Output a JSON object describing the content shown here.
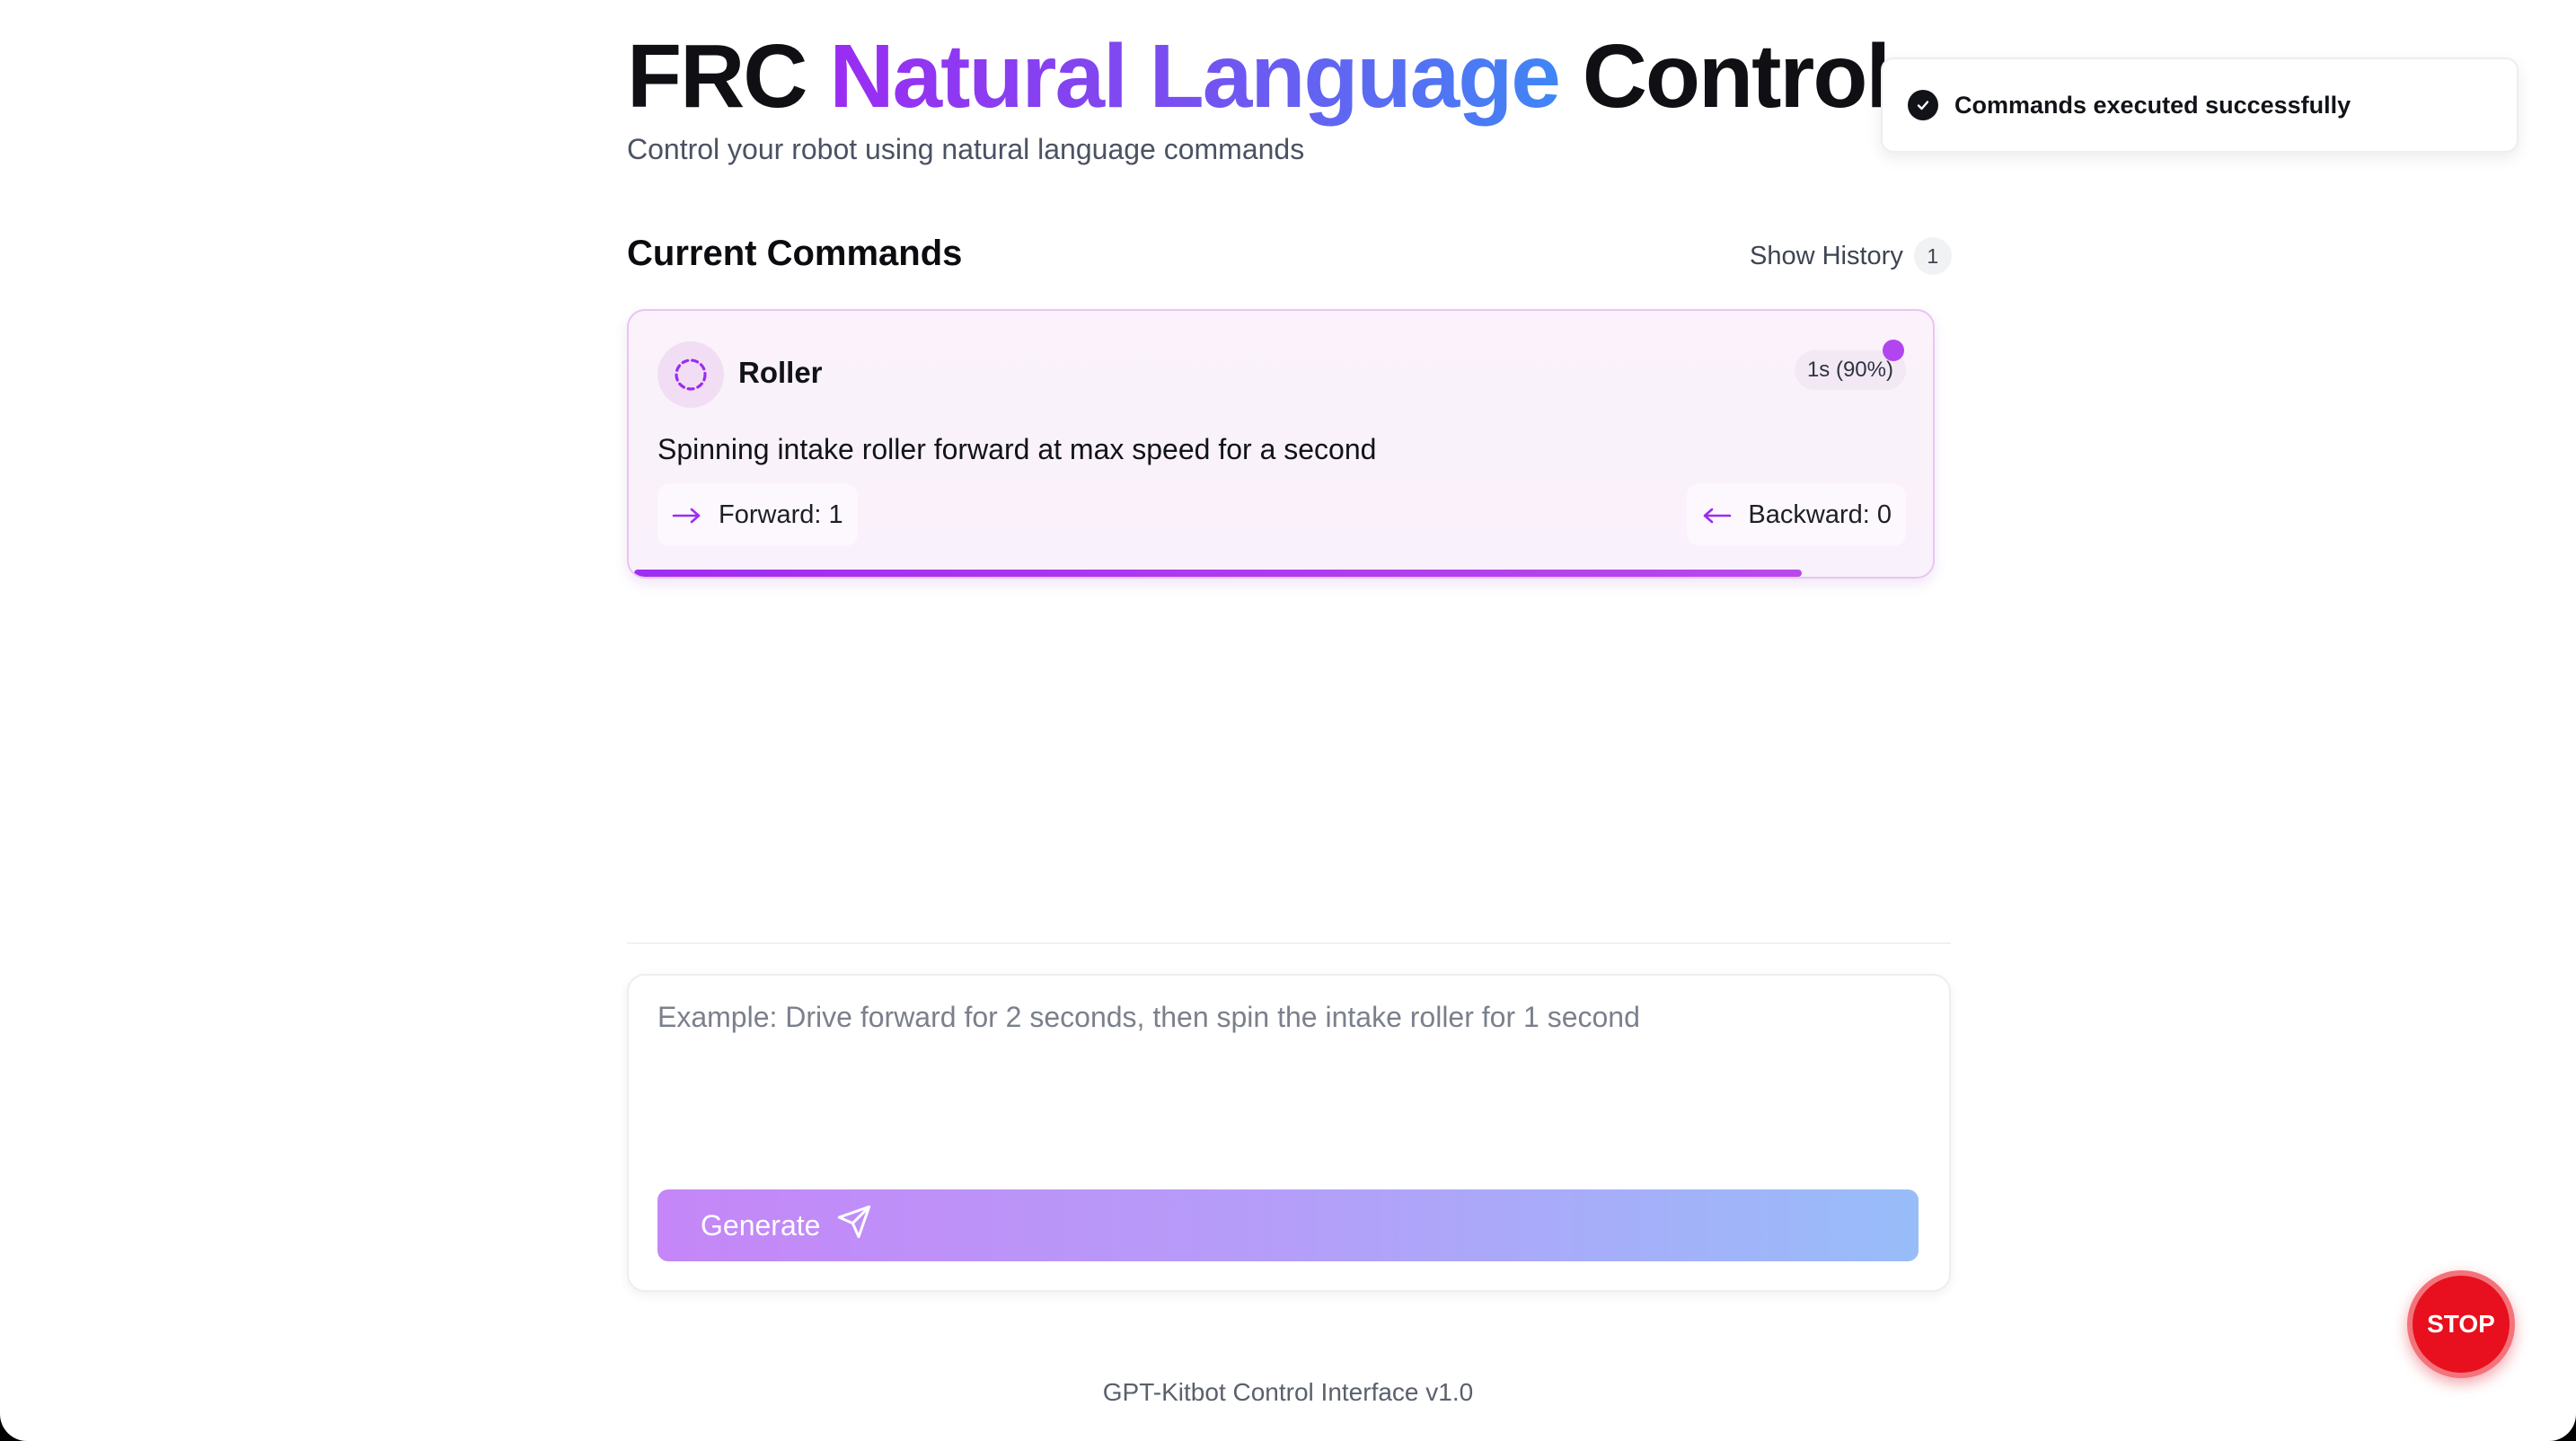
{
  "header": {
    "title_part1": "FRC",
    "title_highlight": "Natural Language",
    "title_part2": "Control",
    "subtitle": "Control your robot using natural language commands"
  },
  "commands_section": {
    "title": "Current Commands",
    "history_label": "Show History",
    "history_count": "1"
  },
  "command_card": {
    "name": "Roller",
    "duration_label": "1s (90%)",
    "description": "Spinning intake roller forward at max speed for a second",
    "forward_label": "Forward: 1",
    "backward_label": "Backward: 0",
    "progress_fraction": 0.9,
    "icons": {
      "roller": "loader-dashed-circle-icon",
      "forward": "arrow-right-icon",
      "backward": "arrow-left-icon"
    }
  },
  "input": {
    "placeholder": "Example: Drive forward for 2 seconds, then spin the intake roller for 1 second",
    "value": "",
    "generate_label": "Generate"
  },
  "toast": {
    "message": "Commands executed successfully"
  },
  "stop_button": {
    "label": "STOP"
  },
  "footer": {
    "text": "GPT-Kitbot Control Interface v1.0"
  },
  "colors": {
    "accent_purple": "#9b2cf2",
    "accent_blue": "#3f86f5",
    "stop_red": "#e8101e"
  }
}
